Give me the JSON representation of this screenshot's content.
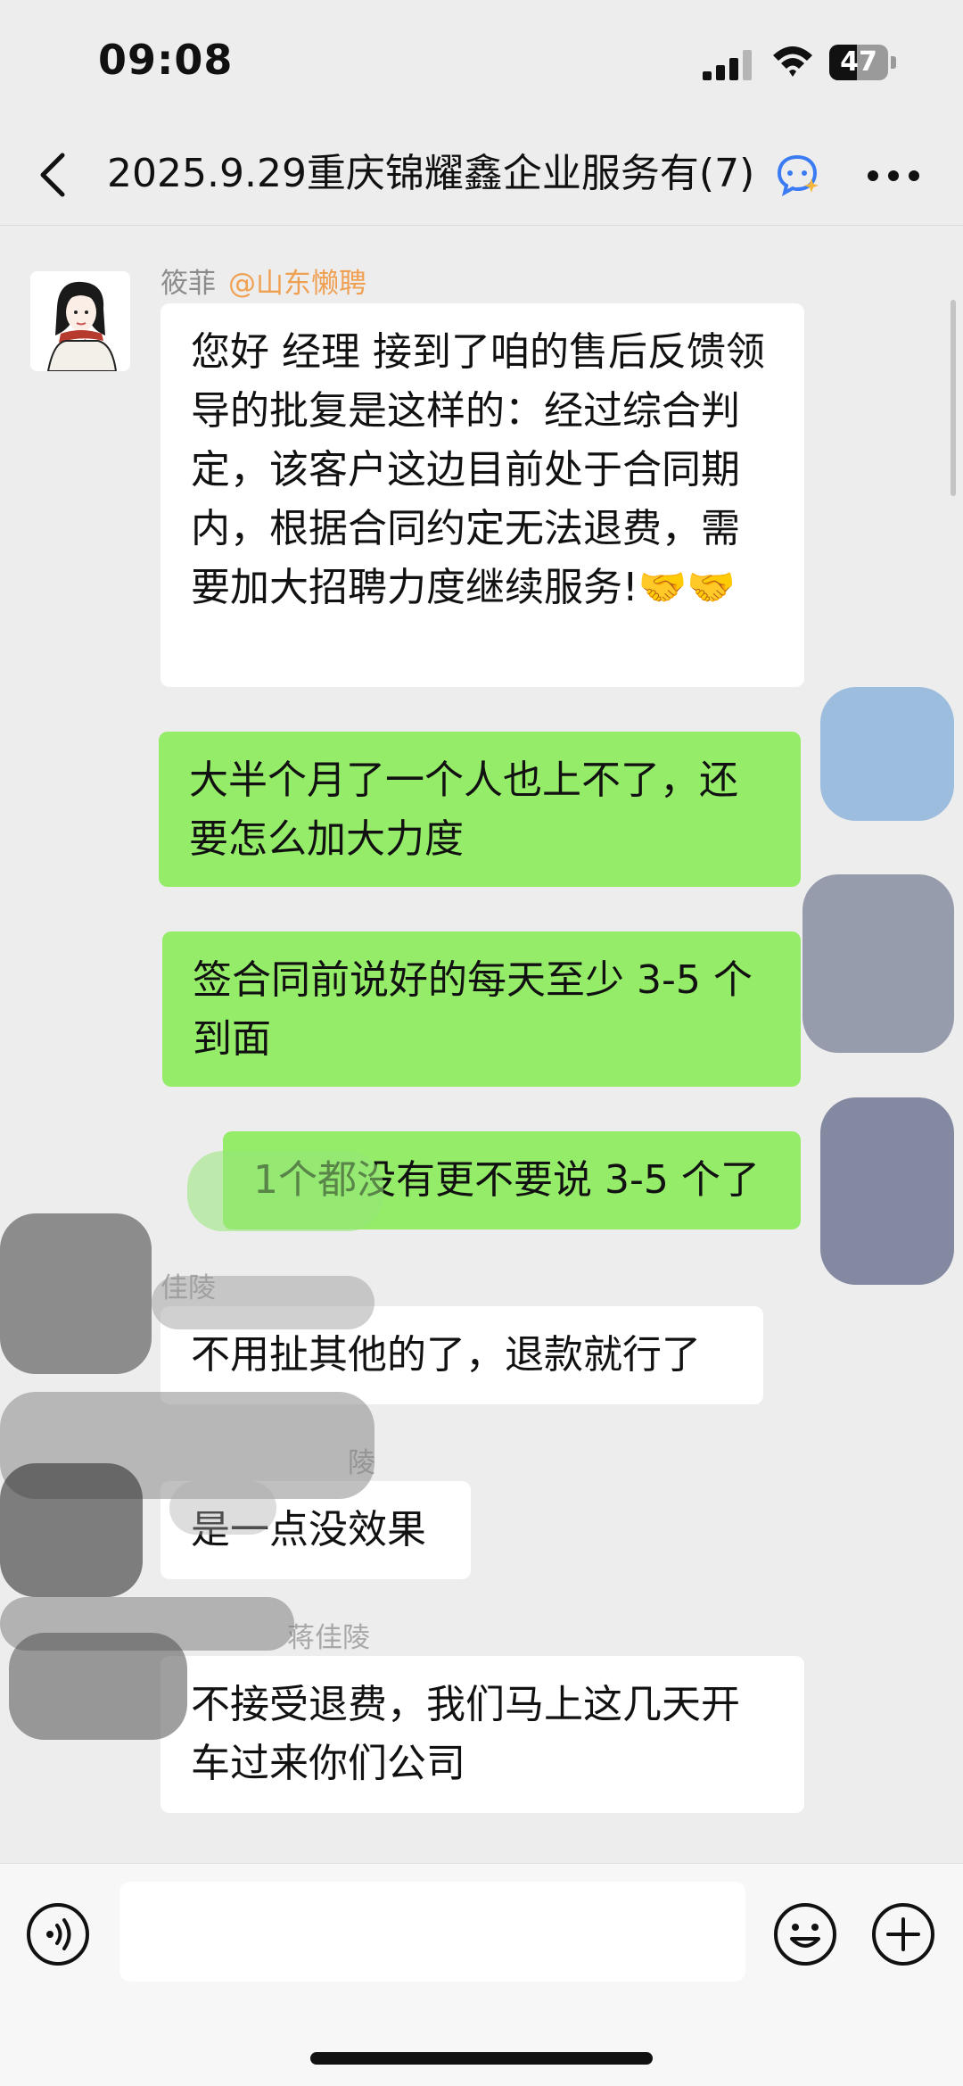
{
  "status_bar": {
    "time": "09:08",
    "battery": "47",
    "battery_level": 0.47
  },
  "nav": {
    "title": "2025.9.29重庆锦耀鑫企业服务有(7)"
  },
  "messages": [
    {
      "sender": "筱菲",
      "mention": "@山东懒聘",
      "text": "您好 经理 接到了咱的售后反馈领导的批复是这样的：经过综合判定，该客户这边目前处于合同期内，根据合同约定无法退费，需要加大招聘力度继续服务!🤝🤝"
    },
    {
      "text": "大半个月了一个人也上不了，还要怎么加大力度"
    },
    {
      "text": "签合同前说好的每天至少 3-5 个到面"
    },
    {
      "text": "1个都没有更不要说 3-5 个了"
    },
    {
      "sender": "佳陵",
      "text": "不用扯其他的了，退款就行了"
    },
    {
      "sender": "陵",
      "text": "是一点没效果"
    },
    {
      "sender": "蒋佳陵",
      "text": "不接受退费，我们马上这几天开车过来你们公司"
    }
  ],
  "input": {
    "placeholder": ""
  }
}
